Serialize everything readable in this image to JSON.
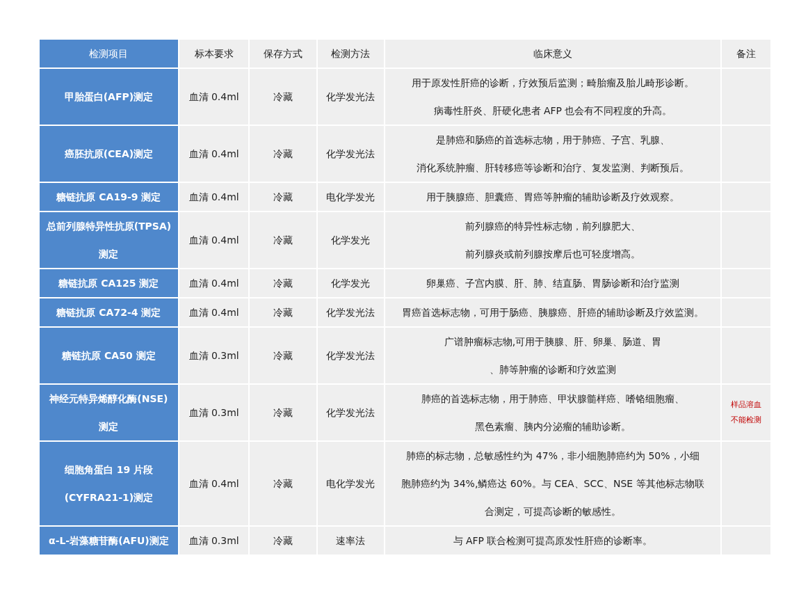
{
  "table": {
    "columns": [
      "检测项目",
      "标本要求",
      "保存方式",
      "检测方法",
      "临床意义",
      "备注"
    ],
    "rows": [
      {
        "item": [
          "甲胎蛋白(AFP)测定"
        ],
        "specimen": "血清 0.4ml",
        "storage": "冷藏",
        "method": "化学发光法",
        "significance": [
          "用于原发性肝癌的诊断，疗效预后监测；畸胎瘤及胎儿畸形诊断。",
          "病毒性肝炎、肝硬化患者 AFP 也会有不同程度的升高。"
        ],
        "note": []
      },
      {
        "item": [
          "癌胚抗原(CEA)测定"
        ],
        "specimen": "血清 0.4ml",
        "storage": "冷藏",
        "method": "化学发光法",
        "significance": [
          "是肺癌和肠癌的首选标志物，用于肺癌、子宫、乳腺、",
          "消化系统肿瘤、肝转移癌等诊断和治疗、复发监测、判断预后。"
        ],
        "note": []
      },
      {
        "item": [
          "糖链抗原 CA19-9 测定"
        ],
        "specimen": "血清 0.4ml",
        "storage": "冷藏",
        "method": "电化学发光",
        "significance": [
          "用于胰腺癌、胆囊癌、胃癌等肿瘤的辅助诊断及疗效观察。"
        ],
        "note": []
      },
      {
        "item": [
          "总前列腺特异性抗原(TPSA)",
          "测定"
        ],
        "specimen": "血清 0.4ml",
        "storage": "冷藏",
        "method": "化学发光",
        "significance": [
          "前列腺癌的特异性标志物，前列腺肥大、",
          "前列腺炎或前列腺按摩后也可轻度增高。"
        ],
        "note": []
      },
      {
        "item": [
          "糖链抗原 CA125 测定"
        ],
        "specimen": "血清 0.4ml",
        "storage": "冷藏",
        "method": "化学发光",
        "significance": [
          "卵巢癌、子宫内膜、肝、肺、结直肠、胃肠诊断和治疗监测"
        ],
        "note": []
      },
      {
        "item": [
          "糖链抗原 CA72-4 测定"
        ],
        "specimen": "血清 0.4ml",
        "storage": "冷藏",
        "method": "化学发光法",
        "significance": [
          "胃癌首选标志物，可用于肠癌、胰腺癌、肝癌的辅助诊断及疗效监测。"
        ],
        "note": []
      },
      {
        "item": [
          "糖链抗原 CA50 测定"
        ],
        "specimen": "血清 0.3ml",
        "storage": "冷藏",
        "method": "化学发光法",
        "significance": [
          "广谱肿瘤标志物,可用于胰腺、肝、卵巢、肠道、胃",
          "、肺等肿瘤的诊断和疗效监测"
        ],
        "note": []
      },
      {
        "item": [
          "神经元特异烯醇化酶(NSE)",
          "测定"
        ],
        "specimen": "血清 0.3ml",
        "storage": "冷藏",
        "method": "化学发光法",
        "significance": [
          "肺癌的首选标志物，用于肺癌、甲状腺髓样癌、嗜铬细胞瘤、",
          "黑色素瘤、胰内分泌瘤的辅助诊断。"
        ],
        "note": [
          "样品溶血",
          "不能检测"
        ]
      },
      {
        "item": [
          "细胞角蛋白 19 片段",
          "(CYFRA21-1)测定"
        ],
        "specimen": "血清 0.4ml",
        "storage": "冷藏",
        "method": "电化学发光",
        "significance": [
          "肺癌的标志物，总敏感性约为 47%，非小细胞肺癌约为 50%，小细",
          "胞肺癌约为 34%,鳞癌达 60%。与 CEA、SCC、NSE 等其他标志物联",
          "合测定，可提高诊断的敏感性。"
        ],
        "note": []
      },
      {
        "item": [
          "α-L-岩藻糖苷酶(AFU)测定"
        ],
        "specimen": "血清 0.3ml",
        "storage": "冷藏",
        "method": "速率法",
        "significance": [
          "与 AFP 联合检测可提高原发性肝癌的诊断率。"
        ],
        "note": []
      }
    ]
  }
}
